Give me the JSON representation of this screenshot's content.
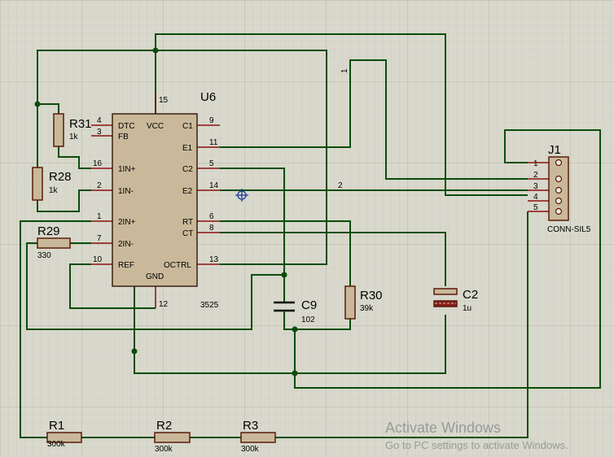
{
  "ic": {
    "ref": "U6",
    "value": "3525",
    "pins": {
      "dtc": {
        "num": "4",
        "label": "DTC"
      },
      "fb": {
        "num": "3",
        "label": "FB"
      },
      "in1p": {
        "num": "16",
        "label": "1IN+"
      },
      "in1m": {
        "num": "2",
        "label": "1IN-"
      },
      "in2p": {
        "num": "1",
        "label": "2IN+"
      },
      "in2m": {
        "num": "7",
        "label": "2IN-"
      },
      "ref": {
        "num": "10",
        "label": "REF"
      },
      "vcc": {
        "num": "15",
        "label": "VCC"
      },
      "gnd": {
        "num": "12",
        "label": "GND"
      },
      "c1": {
        "num": "9",
        "label": "C1"
      },
      "e1": {
        "num": "11",
        "label": "E1"
      },
      "c2": {
        "num": "5",
        "label": "C2"
      },
      "e2": {
        "num": "14",
        "label": "E2"
      },
      "rt": {
        "num": "6",
        "label": "RT"
      },
      "ct": {
        "num": "8",
        "label": "CT"
      },
      "octrl": {
        "num": "13",
        "label": "OCTRL"
      }
    }
  },
  "resistors": {
    "r31": {
      "ref": "R31",
      "value": "1k"
    },
    "r28": {
      "ref": "R28",
      "value": "1k"
    },
    "r29": {
      "ref": "R29",
      "value": "330"
    },
    "r30": {
      "ref": "R30",
      "value": "39k"
    },
    "r1": {
      "ref": "R1",
      "value": "300k"
    },
    "r2": {
      "ref": "R2",
      "value": "300k"
    },
    "r3": {
      "ref": "R3",
      "value": "300k"
    }
  },
  "capacitors": {
    "c9": {
      "ref": "C9",
      "value": "102"
    },
    "c2": {
      "ref": "C2",
      "value": "1u"
    }
  },
  "connector": {
    "ref": "J1",
    "value": "CONN-SIL5",
    "pins": [
      "1",
      "2",
      "3",
      "4",
      "5"
    ]
  },
  "net_labels": {
    "n1": "1",
    "n2": "2"
  },
  "watermark": {
    "title": "Activate Windows",
    "subtitle": "Go to PC settings to activate Windows."
  },
  "colors": {
    "background": "#d8d8cc",
    "wire": "#0a4d0a",
    "pin": "#8a1010",
    "component_fill": "#c9b99a",
    "component_outline": "#5a1a0a"
  }
}
